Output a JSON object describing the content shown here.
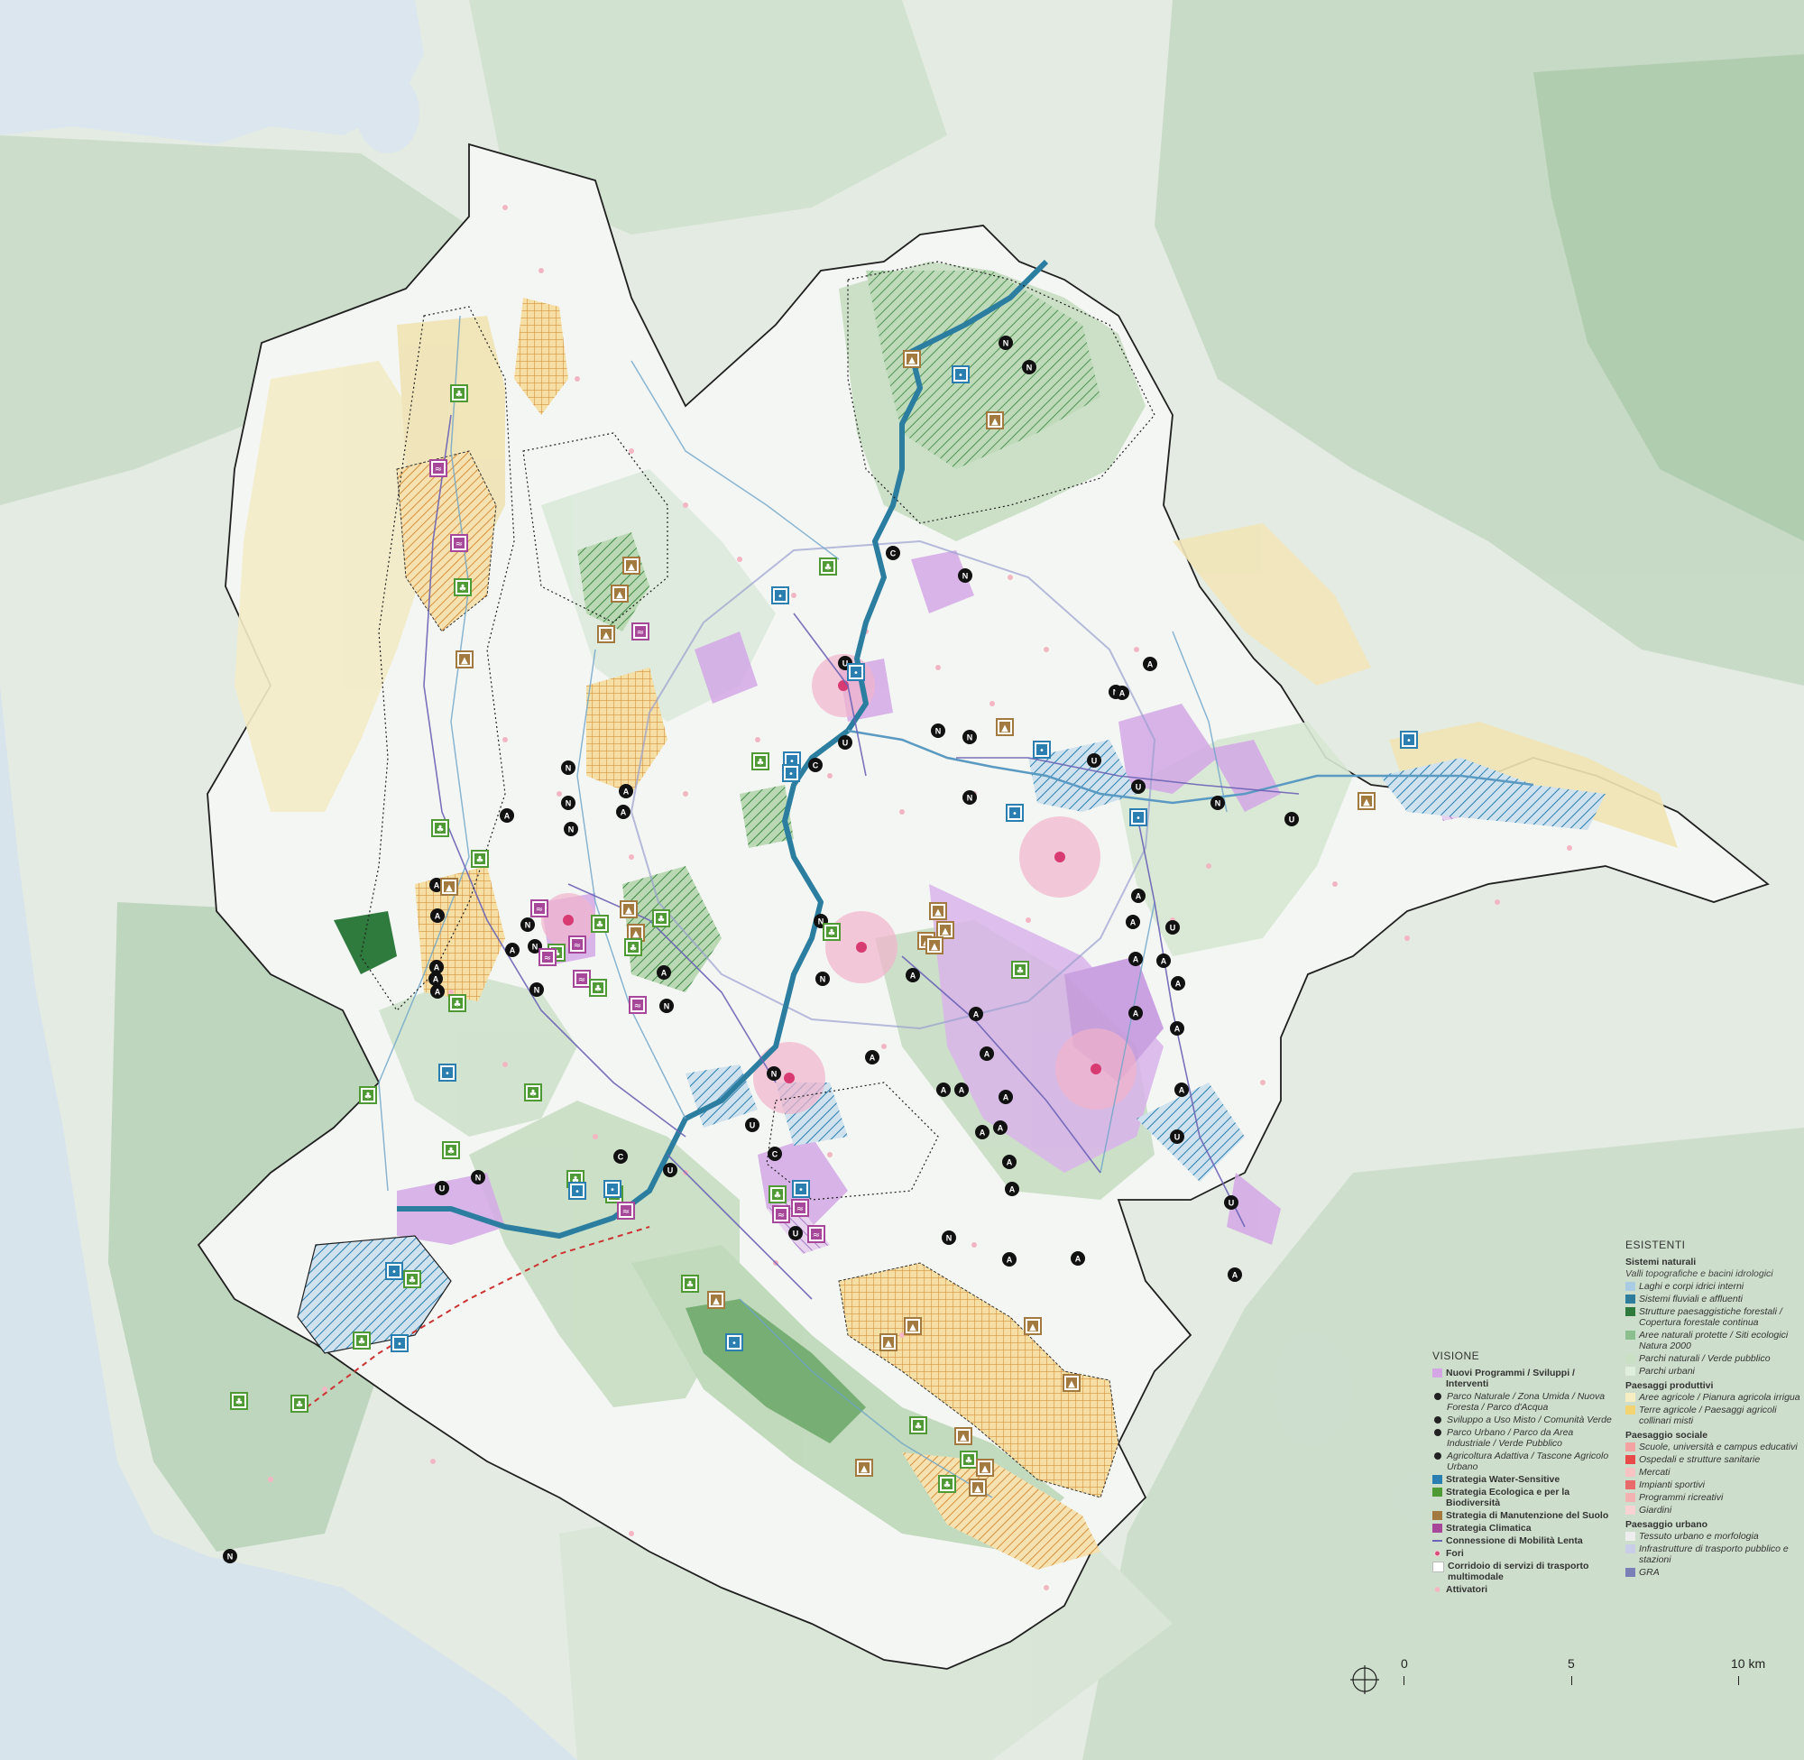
{
  "legend_existing": {
    "title": "ESISTENTI",
    "groups": [
      {
        "heading": "Sistemi naturali",
        "subtitle": "Valli topografiche e bacini idrologici",
        "items": [
          {
            "label": "Laghi e corpi idrici interni",
            "color": "#a9cbe3"
          },
          {
            "label": "Sistemi fluviali e affluenti",
            "color": "#2e7d9c"
          },
          {
            "label": "Strutture paesaggistiche forestali / Copertura forestale continua",
            "color": "#2f7a3d"
          },
          {
            "label": "Aree naturali protette / Siti ecologici Natura 2000",
            "color": "#8cbf8e"
          },
          {
            "label": "Parchi naturali / Verde pubblico",
            "color": "#c9e0c5"
          },
          {
            "label": "Parchi urbani",
            "color": "#dfeede"
          }
        ]
      },
      {
        "heading": "Paesaggi produttivi",
        "items": [
          {
            "label": "Aree agricole / Pianura agricola irrigua",
            "color": "#f7edc3"
          },
          {
            "label": "Terre agricole / Paesaggi agricoli collinari misti",
            "color": "#f2d472"
          }
        ]
      },
      {
        "heading": "Paesaggio sociale",
        "items": [
          {
            "label": "Scuole, università e campus educativi",
            "color": "#f4a3a3"
          },
          {
            "label": "Ospedali e strutture sanitarie",
            "color": "#e84a4a"
          },
          {
            "label": "Mercati",
            "color": "#f7c3c3"
          },
          {
            "label": "Impianti sportivi",
            "color": "#e96a6a"
          },
          {
            "label": "Programmi ricreativi",
            "color": "#f3b1b1"
          },
          {
            "label": "Giardini",
            "color": "#f9d3d3"
          }
        ]
      },
      {
        "heading": "Paesaggio urbano",
        "items": [
          {
            "label": "Tessuto urbano e morfologia",
            "color": "#eeeeee"
          },
          {
            "label": "Infrastrutture di trasporto pubblico e stazioni",
            "color": "#c9cde8"
          },
          {
            "label": "GRA",
            "color": "#7a7fb8"
          }
        ]
      }
    ]
  },
  "legend_vision": {
    "title": "VISIONE",
    "items": [
      {
        "label": "Nuovi Programmi / Sviluppi / Interventi",
        "style": "bold",
        "color": "#d4a6e6",
        "icon": "purple-square"
      },
      {
        "label": "Parco Naturale / Zona Umida / Nuova Foresta / Parco d'Acqua",
        "style": "ital",
        "icon": "black-pin"
      },
      {
        "label": "Sviluppo a Uso Misto / Comunità Verde",
        "style": "ital",
        "icon": "black-pin"
      },
      {
        "label": "Parco Urbano / Parco da Area Industriale / Verde Pubblico",
        "style": "ital",
        "icon": "black-pin"
      },
      {
        "label": "Agricoltura Adattiva / Tascone Agricolo Urbano",
        "style": "ital",
        "icon": "black-pin"
      },
      {
        "label": "Strategia Water-Sensitive",
        "style": "bold",
        "color": "#2a7fb0",
        "icon": "water-icon"
      },
      {
        "label": "Strategia Ecologica e per la Biodiversità",
        "style": "bold",
        "color": "#4f9a35",
        "icon": "tree-icon"
      },
      {
        "label": "Strategia di Manutenzione del Suolo",
        "style": "bold",
        "color": "#a27a3f",
        "icon": "soil-icon"
      },
      {
        "label": "Strategia Climatica",
        "style": "bold",
        "color": "#a6479a",
        "icon": "heat-icon"
      },
      {
        "label": "Connessione di Mobilità Lenta",
        "style": "bold",
        "color": "#6b63b5",
        "icon": "arrow-line"
      },
      {
        "label": "Fori",
        "style": "bold",
        "color": "#d94c7a",
        "icon": "pink-dot"
      },
      {
        "label": "Corridoio di servizi di trasporto multimodale",
        "style": "bold",
        "color": "#ffffff",
        "icon": "white-box"
      },
      {
        "label": "Attivatori",
        "style": "bold",
        "color": "#f4b6c2",
        "icon": "pink-dots"
      }
    ]
  },
  "markers": {
    "letters": [
      "N",
      "C",
      "U",
      "A"
    ],
    "icon_types": [
      "water-icon",
      "tree-icon",
      "soil-icon",
      "heat-icon"
    ]
  },
  "scale": {
    "labels": [
      "0",
      "5",
      "10 km"
    ],
    "north_icon": "north-arrow-icon"
  },
  "colors": {
    "background": "#e4ebe3",
    "boundary": "#222222",
    "river": "#2b7ea0",
    "water_strategy": "#2a7fb0",
    "eco_strategy": "#4f9a35",
    "soil_strategy": "#a27a3f",
    "climate_strategy": "#a6479a",
    "programs": "#d4a6e6",
    "fori": "#e2507e",
    "sea": "#dbe6ee"
  }
}
